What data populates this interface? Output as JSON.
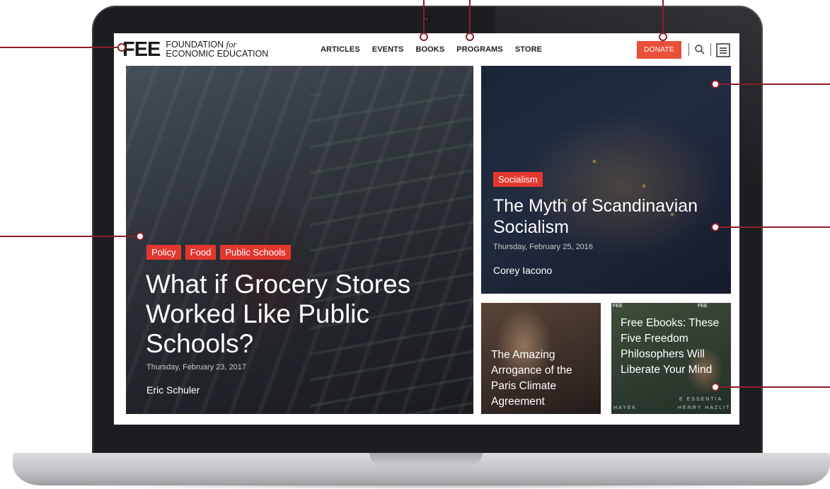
{
  "header": {
    "logo_mark": "FEE",
    "logo_line1_prefix": "FOUNDATION ",
    "logo_line1_for": "for",
    "logo_line2": "ECONOMIC EDUCATION",
    "nav": [
      "ARTICLES",
      "EVENTS",
      "BOOKS",
      "PROGRAMS",
      "STORE"
    ],
    "donate_label": "DONATE"
  },
  "featured": {
    "tags": [
      "Policy",
      "Food",
      "Public Schools"
    ],
    "title": "What if Grocery Stores Worked Like Public Schools?",
    "date": "Thursday, February 23, 2017",
    "author": "Eric Schuler"
  },
  "secondary": {
    "tag": "Socialism",
    "title": "The Myth of Scandinavian Socialism",
    "date": "Thursday, February 25, 2016",
    "author": "Corey Iacono"
  },
  "small_tiles": {
    "climate_title": "The Amazing Arrogance of the Paris Climate Agreement",
    "ebooks_title": "Free Ebooks: These Five Freedom Philosophers Will Liberate Your Mind",
    "ebooks_overlay": {
      "fee_left": "FEE",
      "fee_right": "FEE",
      "caption_left": "HAYEK",
      "caption_right": "HENRY HAZLIT",
      "caption_mid": "E ESSENTIA"
    }
  },
  "colors": {
    "accent": "#e3372e",
    "donate": "#e8503a",
    "callout_line": "#8a1f2a",
    "laptop_bezel": "#1c1d20"
  },
  "icons": [
    "search-icon",
    "menu-icon",
    "camera-icon"
  ]
}
